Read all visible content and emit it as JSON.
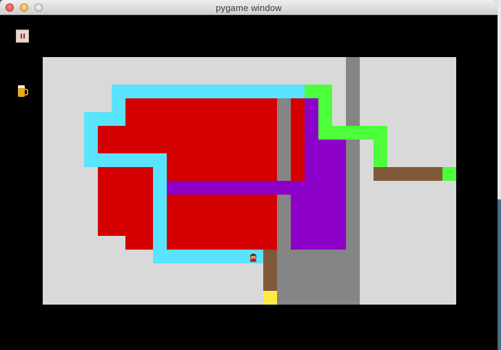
{
  "window": {
    "title": "pygame window"
  },
  "hud": {
    "pause_icon": "pause-icon",
    "item_icon": "beer-mug-icon"
  },
  "colors": {
    "floor": "#d9d9d9",
    "red": "#d40000",
    "cyan": "#5ae3ff",
    "green": "#4cff3a",
    "purple": "#8c00c8",
    "gray": "#858585",
    "brown": "#80583a",
    "yellow": "#ffea4a"
  }
}
